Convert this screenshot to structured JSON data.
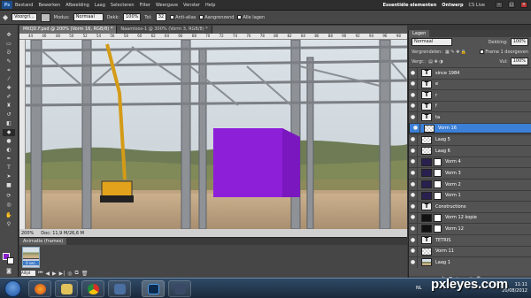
{
  "app": {
    "logo": "Ps",
    "menu": [
      "Bestand",
      "Bewerken",
      "Afbeelding",
      "Laag",
      "Selecteren",
      "Filter",
      "Weergave",
      "Venster",
      "Help"
    ],
    "workspace_label": "Essentiële elementen",
    "workspace_secondary": "Ontwerp",
    "cslive_label": "CS Live"
  },
  "options": {
    "tool_preset": "Voorgrl...",
    "mode_label": "Modus:",
    "mode_value": "Normaal",
    "opacity_label": "Dekk:",
    "opacity_value": "100%",
    "tolerance_label": "Tol:",
    "tolerance_value": "32",
    "antialias_label": "Anti-alias",
    "contiguous_label": "Aangrenzend",
    "all_layers_label": "Alle lagen"
  },
  "tabs": [
    {
      "label": "MKQD.F.psd @ 200% (Vorm 16, RGB/8) *",
      "active": true
    },
    {
      "label": "Naamloos-1 @ 300% (Vorm 3, RGB/8) *",
      "active": false
    }
  ],
  "ruler_ticks": [
    "44",
    "46",
    "48",
    "50",
    "52",
    "54",
    "56",
    "58",
    "60",
    "62",
    "64",
    "66",
    "68",
    "70",
    "72",
    "74",
    "76",
    "78",
    "80",
    "82",
    "84",
    "86",
    "88",
    "90",
    "92",
    "94",
    "96",
    "98"
  ],
  "status": {
    "zoom": "200%",
    "doc": "Doc: 11,9 M/26,6 M"
  },
  "animation": {
    "tab_label": "Animatie (frames)",
    "frame_label": "0 sec.",
    "loop_label": "Altijd"
  },
  "layers_panel": {
    "tab_label": "Lagen",
    "blend_mode": "Normaal",
    "opacity_label": "Dekking:",
    "opacity_value": "100%",
    "lock_label": "Vergrendelen:",
    "propagate_label": "Frame 1 doorgeven",
    "unify_label": "Vergr.:",
    "fill_label": "Vul:",
    "fill_value": "100%",
    "layers": [
      {
        "name": "since 1984",
        "thumb": "t",
        "selected": false
      },
      {
        "name": "e",
        "thumb": "t",
        "selected": false
      },
      {
        "name": "r",
        "thumb": "t",
        "selected": false
      },
      {
        "name": "f",
        "thumb": "t",
        "selected": false
      },
      {
        "name": "ta",
        "thumb": "t",
        "selected": false
      },
      {
        "name": "Vorm 16",
        "thumb": "chk",
        "selected": true
      },
      {
        "name": "Laag 5",
        "thumb": "chk",
        "selected": false
      },
      {
        "name": "Laag 6",
        "thumb": "chk",
        "selected": false
      },
      {
        "name": "Vorm 4",
        "thumb": "purp",
        "selected": false
      },
      {
        "name": "Vorm 3",
        "thumb": "purp",
        "selected": false
      },
      {
        "name": "Vorm 2",
        "thumb": "purp",
        "selected": false
      },
      {
        "name": "Vorm 1",
        "thumb": "purp",
        "selected": false
      },
      {
        "name": "Constructions",
        "thumb": "t",
        "selected": false
      },
      {
        "name": "Vorm 12 kopie",
        "thumb": "blk",
        "selected": false
      },
      {
        "name": "Vorm 12",
        "thumb": "blk",
        "selected": false
      },
      {
        "name": "TETRIS",
        "thumb": "t",
        "selected": false
      },
      {
        "name": "Vorm 11",
        "thumb": "chk",
        "selected": false
      },
      {
        "name": "Laag 1",
        "thumb": "photo",
        "selected": false
      }
    ]
  },
  "taskbar": {
    "lang": "NL",
    "time": "11:11",
    "date": "20/08/2012"
  },
  "watermark": "pxleyes.com",
  "colors": {
    "foreground": "#8a1ec8",
    "background": "#ffffff",
    "shape_fill": "#8e1fd8",
    "selection": "#3c7fd7"
  }
}
